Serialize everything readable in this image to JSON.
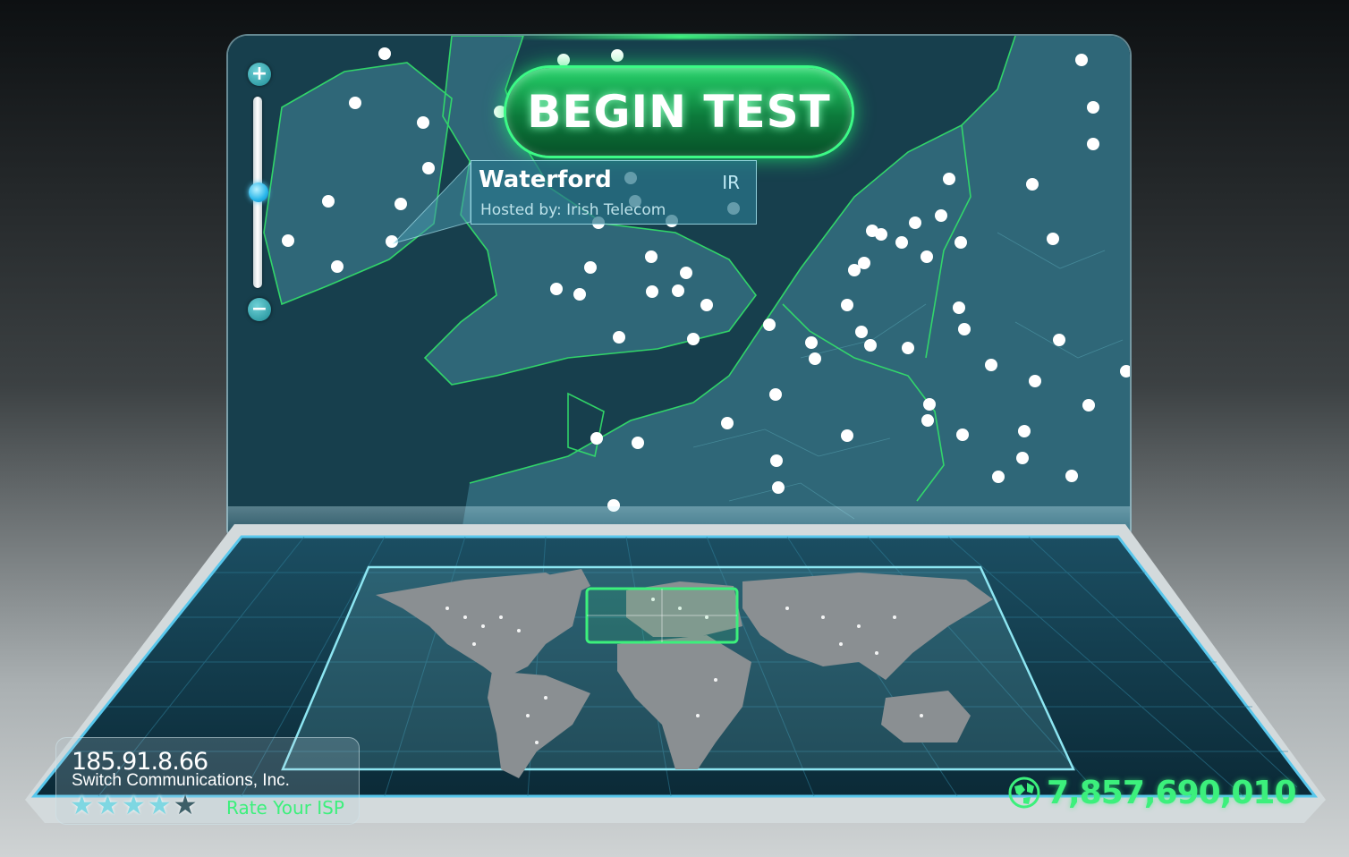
{
  "begin_test_label": "BEGIN TEST",
  "zoom": {
    "in_symbol": "+",
    "out_symbol": "−"
  },
  "server": {
    "city": "Waterford",
    "country": "IR",
    "host": "Hosted by: Irish Telecom"
  },
  "client": {
    "ip": "185.91.8.66",
    "isp": "Switch Communications, Inc.",
    "rating": 4,
    "rating_max": 5,
    "rate_label": "Rate Your ISP"
  },
  "counter": {
    "value": "7,857,690,010",
    "icon": "globe-icon"
  },
  "colors": {
    "accent_green": "#3cf07c",
    "map_land": "#2c6173",
    "map_sea": "#1c4a5a",
    "border_glow": "#33e36a"
  }
}
